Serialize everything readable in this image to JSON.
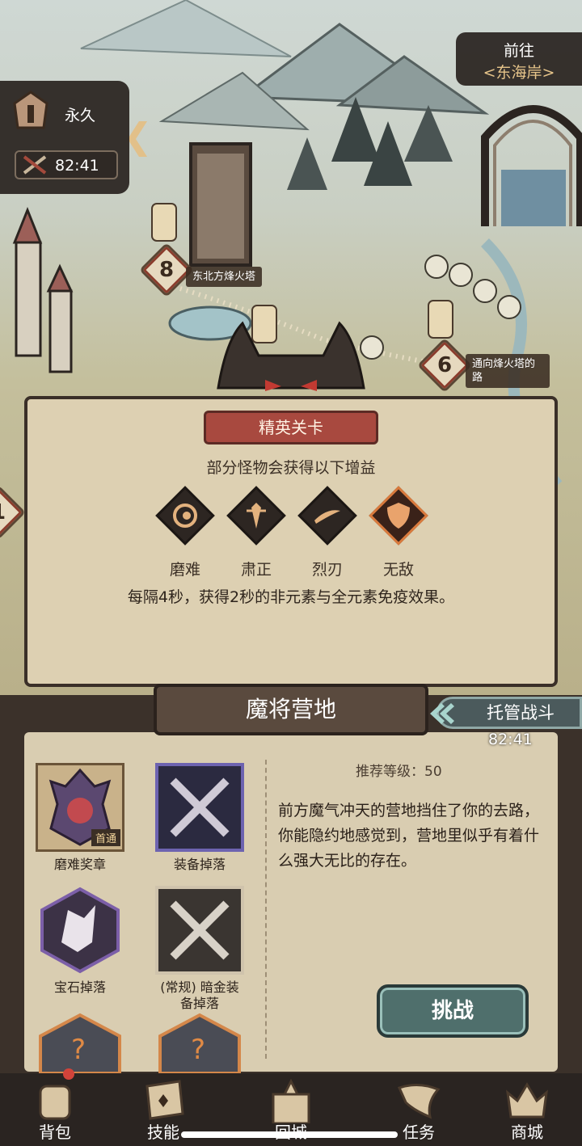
{
  "status": {
    "permanent_label": "永久",
    "timer": "82:41"
  },
  "goto": {
    "title": "前往",
    "destination": "<东海岸>"
  },
  "map_nodes": [
    {
      "number": "8",
      "label": "东北方烽火塔"
    },
    {
      "number": "6",
      "label": "通向烽火塔的路"
    },
    {
      "number": "1",
      "label": ""
    }
  ],
  "elite": {
    "ribbon": "精英关卡",
    "subtitle": "部分怪物会获得以下增益",
    "buffs": [
      {
        "label": "磨难",
        "icon": "spiral-icon",
        "active": false
      },
      {
        "label": "肃正",
        "icon": "sword-down-icon",
        "active": false
      },
      {
        "label": "烈刃",
        "icon": "slash-icon",
        "active": false
      },
      {
        "label": "无敌",
        "icon": "shield-icon",
        "active": true
      }
    ],
    "description": "每隔4秒，获得2秒的非元素与全元素免疫效果。"
  },
  "stage": {
    "title": "魔将营地",
    "auto_battle": "托管战斗",
    "auto_timer": "82:41",
    "recommended_level": "推荐等级：50",
    "description": "前方魔气冲天的营地挡住了你的去路，你能隐约地感觉到，营地里似乎有着什么强大无比的存在。",
    "challenge": "挑战",
    "rewards": [
      {
        "label": "磨难奖章",
        "badge": "首通"
      },
      {
        "label": "装备掉落"
      },
      {
        "label": "宝石掉落"
      },
      {
        "label": "(常规) 暗金装备掉落"
      }
    ]
  },
  "nav": [
    {
      "label": "背包"
    },
    {
      "label": "技能"
    },
    {
      "label": "回城"
    },
    {
      "label": "任务"
    },
    {
      "label": "商城"
    }
  ],
  "colors": {
    "accent_red": "#a8493f",
    "teal_button": "#4f6f6c",
    "parchment": "#ddd0b2",
    "dark_frame": "#3b312a"
  }
}
